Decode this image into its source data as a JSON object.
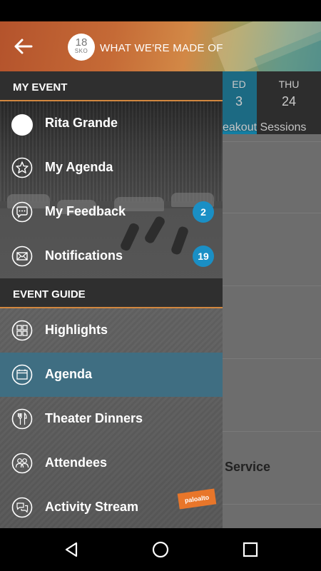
{
  "header": {
    "logo_number": "18",
    "logo_sub": "SKO",
    "title": "WHAT WE'RE MADE OF"
  },
  "background": {
    "days": [
      {
        "name": "ED",
        "number": "3",
        "selected": true
      },
      {
        "name": "THU",
        "number": "24",
        "selected": false
      }
    ],
    "session_text": "eakout Sessions",
    "service_text": "Service"
  },
  "drawer": {
    "my_event_header": "MY EVENT",
    "event_guide_header": "EVENT GUIDE",
    "my_event_items": [
      {
        "label": "Rita Grande",
        "icon": "avatar"
      },
      {
        "label": "My Agenda",
        "icon": "star-icon"
      },
      {
        "label": "My Feedback",
        "icon": "chat-icon",
        "badge": "2"
      },
      {
        "label": "Notifications",
        "icon": "envelope-icon",
        "badge": "19"
      }
    ],
    "event_guide_items": [
      {
        "label": "Highlights",
        "icon": "grid-icon",
        "active": false
      },
      {
        "label": "Agenda",
        "icon": "calendar-icon",
        "active": true
      },
      {
        "label": "Theater Dinners",
        "icon": "fork-knife-icon",
        "active": false
      },
      {
        "label": "Attendees",
        "icon": "people-icon",
        "active": false
      },
      {
        "label": "Activity Stream",
        "icon": "chat-bubbles-icon",
        "active": false
      }
    ],
    "sponsor_label": "paloalto"
  },
  "colors": {
    "accent_orange": "#d2873f",
    "badge_blue": "#1a8fc5",
    "active_item": "#3f6e82"
  }
}
